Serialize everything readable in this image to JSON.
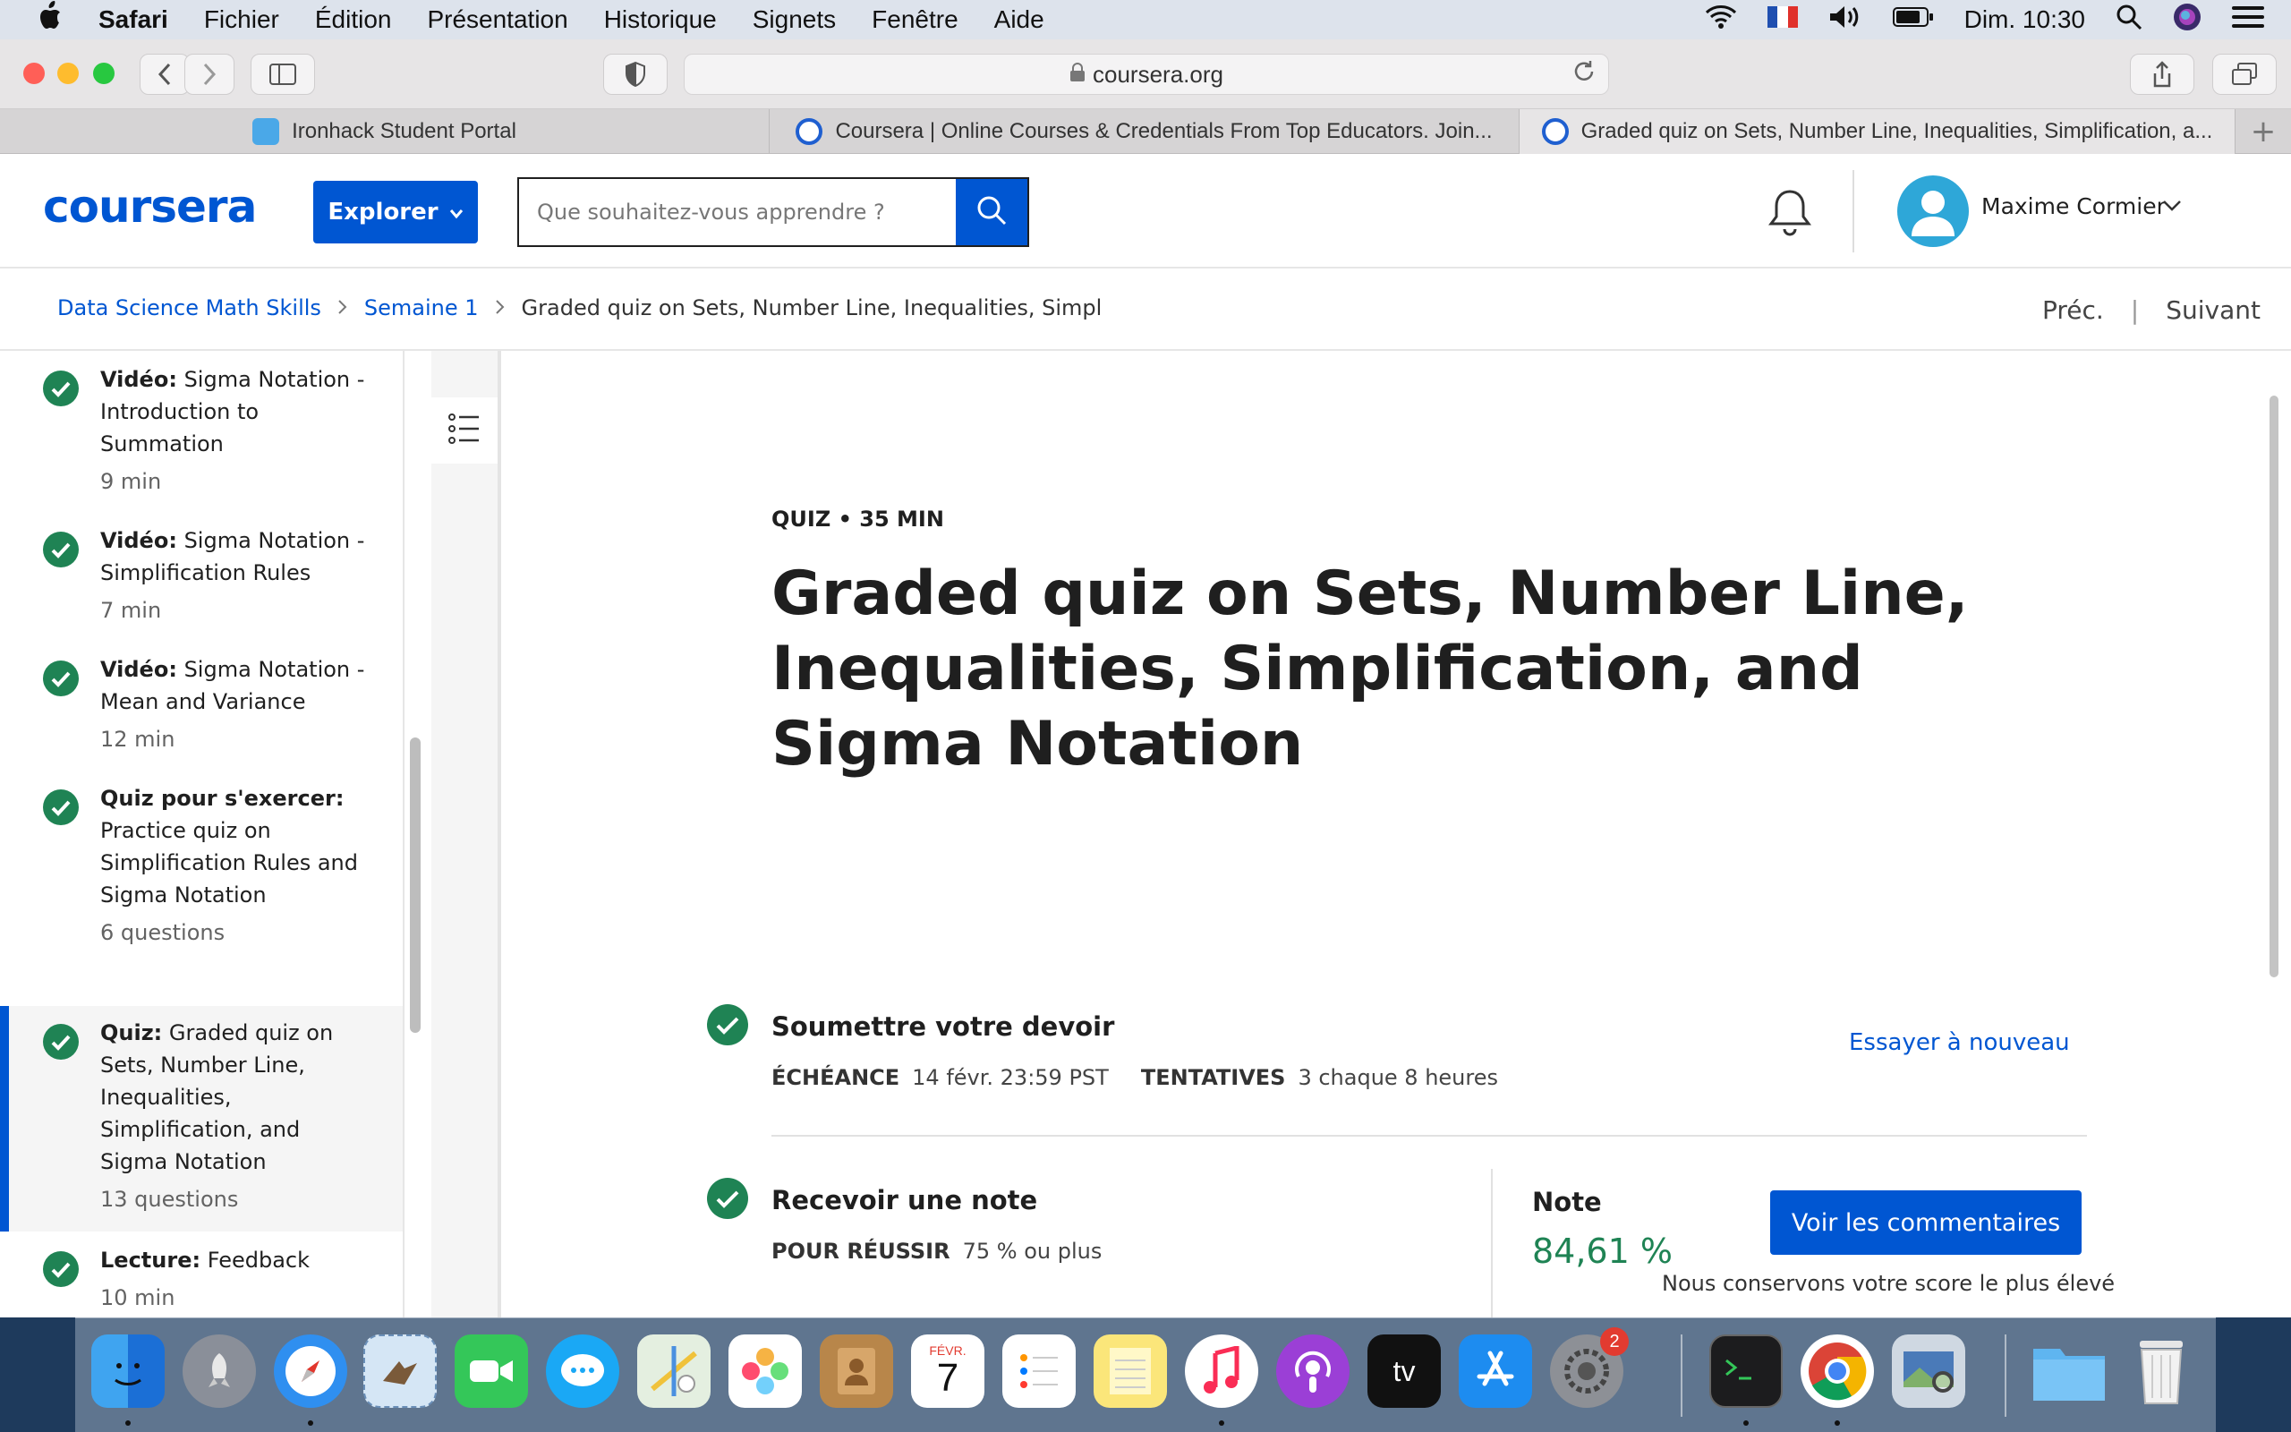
{
  "menubar": {
    "apple": "",
    "app": "Safari",
    "items": [
      "Fichier",
      "Édition",
      "Présentation",
      "Historique",
      "Signets",
      "Fenêtre",
      "Aide"
    ],
    "clock": "Dim. 10:30"
  },
  "browser": {
    "url": "coursera.org",
    "tabs": [
      {
        "label": "Ironhack Student Portal"
      },
      {
        "label": "Coursera | Online Courses & Credentials From Top Educators. Join..."
      },
      {
        "label": "Graded quiz on Sets, Number Line, Inequalities, Simplification, a..."
      }
    ],
    "newtab": "+"
  },
  "header": {
    "logo": "coursera",
    "explore_label": "Explorer",
    "search_placeholder": "Que souhaitez-vous apprendre ?",
    "user_name": "Maxime Cormier"
  },
  "breadcrumb": {
    "items": [
      "Data Science Math Skills",
      "Semaine 1"
    ],
    "current": "Graded quiz on Sets, Number Line, Inequalities, Simpl",
    "prev": "Préc.",
    "next": "Suivant",
    "sep": "|"
  },
  "sidebar": {
    "items": [
      {
        "type": "Vidéo:",
        "title": "Sigma Notation - Introduction to Summation",
        "meta": "9 min"
      },
      {
        "type": "Vidéo:",
        "title": "Sigma Notation - Simplification Rules",
        "meta": "7 min"
      },
      {
        "type": "Vidéo:",
        "title": "Sigma Notation - Mean and Variance",
        "meta": "12 min"
      },
      {
        "type": "Quiz pour s'exercer:",
        "title": "Practice quiz on Simplification Rules and Sigma Notation",
        "meta": "6 questions"
      },
      {
        "type": "Quiz:",
        "title": "Graded quiz on Sets, Number Line, Inequalities, Simplification, and Sigma Notation",
        "meta": "13 questions"
      },
      {
        "type": "Lecture:",
        "title": "Feedback",
        "meta": "10 min"
      }
    ]
  },
  "main": {
    "kicker": "QUIZ • 35 MIN",
    "title": "Graded quiz on Sets, Number Line, Inequalities, Simplification, and Sigma Notation",
    "submit": {
      "title": "Soumettre votre devoir",
      "due_label": "ÉCHÉANCE",
      "due_value": "14 févr. 23:59 PST",
      "attempts_label": "TENTATIVES",
      "attempts_value": "3 chaque 8 heures",
      "retry": "Essayer à nouveau"
    },
    "grade": {
      "title": "Recevoir une note",
      "pass_label": "POUR RÉUSSIR",
      "pass_value": "75 % ou plus",
      "note_label": "Note",
      "note_value": "84,61 %",
      "feedback_button": "Voir les commentaires",
      "keep_note": "Nous conservons votre score le plus élevé"
    }
  },
  "dock": {
    "calendar_month": "FÉVR.",
    "calendar_day": "7",
    "settings_badge": "2",
    "tv_label": "tv"
  },
  "colors": {
    "brand": "#0056d2",
    "success": "#1f8354"
  }
}
